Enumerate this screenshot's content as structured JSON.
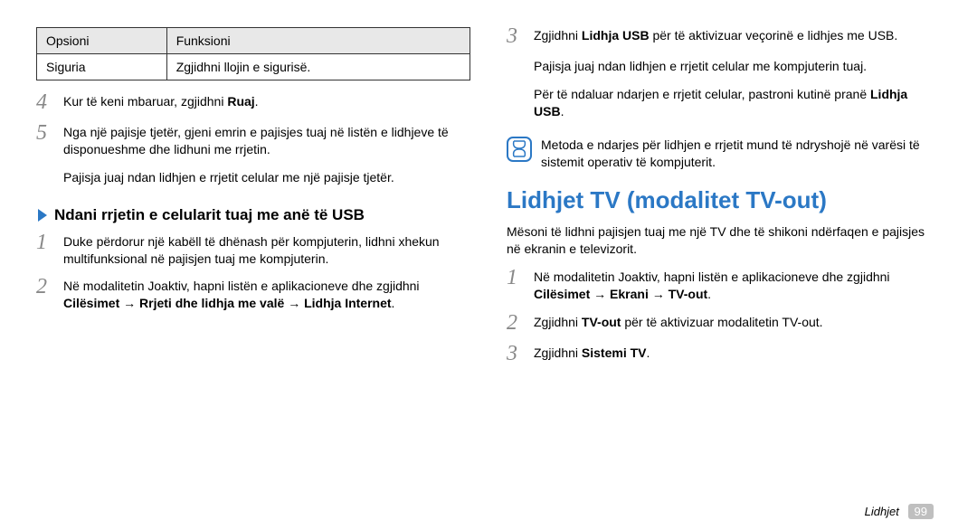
{
  "table": {
    "headers": [
      "Opsioni",
      "Funksioni"
    ],
    "rows": [
      [
        "Siguria",
        "Zgjidhni llojin e sigurisë."
      ]
    ]
  },
  "left": {
    "step4": "Kur të keni mbaruar, zgjidhni ",
    "step4b": "Ruaj",
    "step4c": ".",
    "step5": "Nga një pajisje tjetër, gjeni emrin e pajisjes tuaj në listën e lidhjeve të disponueshme dhe lidhuni me rrjetin.",
    "step5_note": "Pajisja juaj ndan lidhjen e rrjetit celular me një pajisje tjetër.",
    "subhead": "Ndani rrjetin e celularit tuaj me anë të USB",
    "usb1": "Duke përdorur një kabëll të dhënash për kompjuterin, lidhni xhekun multifunksional në pajisjen tuaj me kompjuterin.",
    "usb2a": "Në modalitetin Joaktiv, hapni listën e aplikacioneve dhe zgjidhni ",
    "usb2b": "Cilësimet → Rrjeti dhe lidhja me valë → Lidhja Internet",
    "usb2c": "."
  },
  "right": {
    "r3a": "Zgjidhni ",
    "r3b": "Lidhja USB",
    "r3c": " për të aktivizuar veçorinë e lidhjes me USB.",
    "r3_p1": "Pajisja juaj ndan lidhjen e rrjetit celular me kompjuterin tuaj.",
    "r3_p2a": "Për të ndaluar ndarjen e rrjetit celular, pastroni kutinë pranë ",
    "r3_p2b": "Lidhja USB",
    "r3_p2c": ".",
    "note": "Metoda e ndarjes për lidhjen e rrjetit mund të ndryshojë në varësi të sistemit operativ të kompjuterit.",
    "section_title": "Lidhjet TV (modalitet TV-out)",
    "intro": "Mësoni të lidhni pajisjen tuaj me një TV dhe të shikoni ndërfaqen e pajisjes në ekranin e televizorit.",
    "tv1a": "Në modalitetin Joaktiv, hapni listën e aplikacioneve dhe zgjidhni ",
    "tv1b": "Cilësimet → Ekrani → TV-out",
    "tv1c": ".",
    "tv2a": "Zgjidhni ",
    "tv2b": "TV-out",
    "tv2c": " për të aktivizuar modalitetin TV-out.",
    "tv3a": "Zgjidhni ",
    "tv3b": "Sistemi TV",
    "tv3c": "."
  },
  "footer": {
    "label": "Lidhjet",
    "page": "99"
  }
}
